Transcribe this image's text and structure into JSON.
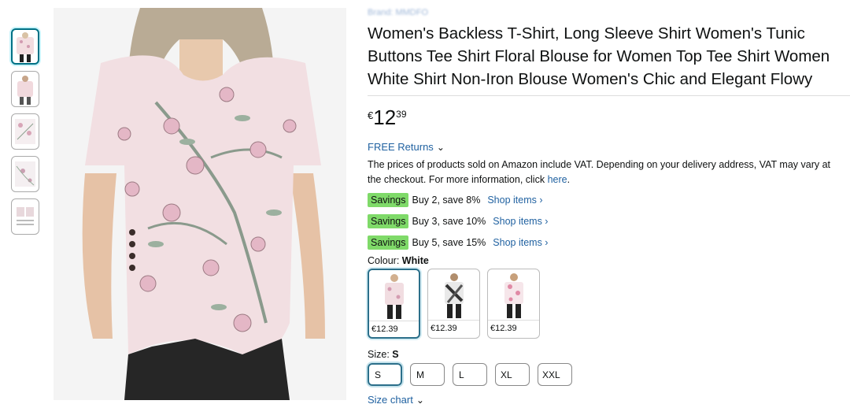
{
  "brand": "Brand: MMDFO",
  "title": "Women's Backless T-Shirt, Long Sleeve Shirt Women's Tunic Buttons Tee Shirt Floral Blouse for Women Top Tee Shirt Women White Shirt Non-Iron Blouse Women's Chic and Elegant Flowy",
  "price": {
    "symbol": "€",
    "whole": "12",
    "fraction": "39"
  },
  "returns": {
    "label": "FREE Returns",
    "icon": "chevron-down-icon"
  },
  "vat": {
    "text": "The prices of products sold on Amazon include VAT. Depending on your delivery address, VAT may vary at the checkout. For more information, click ",
    "link": "here",
    "end": "."
  },
  "savings": [
    {
      "badge": "Savings",
      "text": "Buy 2, save 8%",
      "link": "Shop items ›"
    },
    {
      "badge": "Savings",
      "text": "Buy 3, save 10%",
      "link": "Shop items ›"
    },
    {
      "badge": "Savings",
      "text": "Buy 5, save 15%",
      "link": "Shop items ›"
    }
  ],
  "colour": {
    "label": "Colour: ",
    "value": "White"
  },
  "swatches": [
    {
      "price": "€12.39",
      "selected": true
    },
    {
      "price": "€12.39",
      "selected": false
    },
    {
      "price": "€12.39",
      "selected": false
    }
  ],
  "size": {
    "label": "Size: ",
    "value": "S"
  },
  "sizes": [
    "S",
    "M",
    "L",
    "XL",
    "XXL"
  ],
  "size_chart": {
    "label": "Size chart",
    "icon": "chevron-down-icon"
  },
  "colors": {
    "link": "#2162a1",
    "savings_badge": "#7fda69",
    "selected_border": "#2b6f8a"
  }
}
